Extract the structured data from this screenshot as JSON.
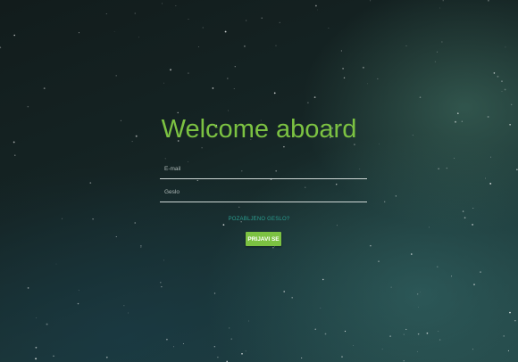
{
  "page": {
    "title": "Welcome aboard"
  },
  "form": {
    "email": {
      "placeholder": "E-mail",
      "value": ""
    },
    "password": {
      "placeholder": "Geslo",
      "value": ""
    },
    "forgot_password_label": "POZABLJENO GESLO?",
    "login_button_label": "PRIJAVI SE"
  },
  "colors": {
    "accent": "#7cc242",
    "link": "#2a9d8f",
    "background": "#13201f"
  }
}
